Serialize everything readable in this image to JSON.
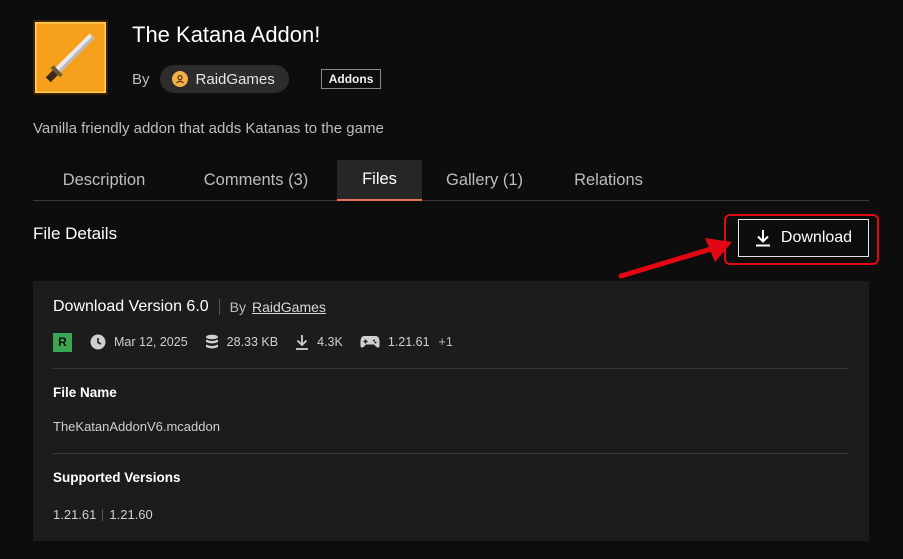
{
  "header": {
    "title": "The Katana Addon!",
    "by_label": "By",
    "author": "RaidGames",
    "tag": "Addons",
    "summary": "Vanilla friendly addon that adds Katanas to the game"
  },
  "tabs": [
    {
      "label": "Description",
      "active": false
    },
    {
      "label": "Comments (3)",
      "active": false
    },
    {
      "label": "Files",
      "active": true
    },
    {
      "label": "Gallery (1)",
      "active": false
    },
    {
      "label": "Relations",
      "active": false
    }
  ],
  "file_details": {
    "section_title": "File Details",
    "download_button": "Download",
    "version_title": "Download Version 6.0",
    "by_label": "By",
    "author": "RaidGames",
    "release_badge": "R",
    "date": "Mar 12, 2025",
    "size": "28.33 KB",
    "downloads": "4.3K",
    "game_version": "1.21.61",
    "game_version_more": "+1",
    "file_name_label": "File Name",
    "file_name": "TheKatanAddonV6.mcaddon",
    "supported_label": "Supported Versions",
    "supported_versions": [
      "1.21.61",
      "1.21.60"
    ]
  },
  "colors": {
    "background": "#0d0d0d",
    "card": "#1c1c1c",
    "tab_active_underline": "#e4705b",
    "highlight_red": "#e30613",
    "release_green": "#3aa553",
    "avatar": "#f3b249"
  },
  "icons": {
    "clock": "clock-icon",
    "size": "database-icon",
    "downloads": "download-icon",
    "game": "gamepad-icon",
    "author": "user-icon"
  }
}
